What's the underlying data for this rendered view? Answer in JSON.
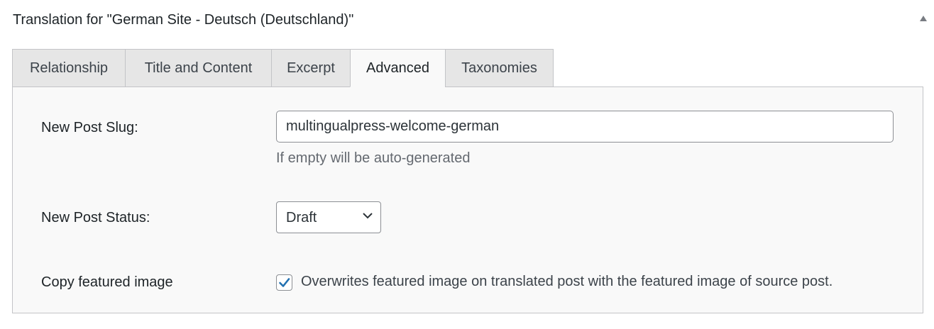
{
  "metabox": {
    "title": "Translation for \"German Site - Deutsch (Deutschland)\""
  },
  "tabs": [
    {
      "label": "Relationship"
    },
    {
      "label": "Title and Content"
    },
    {
      "label": "Excerpt"
    },
    {
      "label": "Advanced",
      "active": true
    },
    {
      "label": "Taxonomies"
    }
  ],
  "advanced": {
    "slug_label": "New Post Slug:",
    "slug_value": "multingualpress-welcome-german",
    "slug_hint": "If empty will be auto-generated",
    "status_label": "New Post Status:",
    "status_value": "Draft",
    "featured_label": "Copy featured image",
    "featured_checked": true,
    "featured_description": "Overwrites featured image on translated post with the featured image of source post."
  },
  "colors": {
    "checkbox_accent": "#2271b1",
    "panel_background": "#f9f9f9",
    "inactive_tab_background": "#e6e6e6",
    "border": "#c3c4c7"
  },
  "icons": {
    "toggle": "arrow-up-icon",
    "select": "chevron-down-icon",
    "checkbox": "checkmark-icon"
  }
}
